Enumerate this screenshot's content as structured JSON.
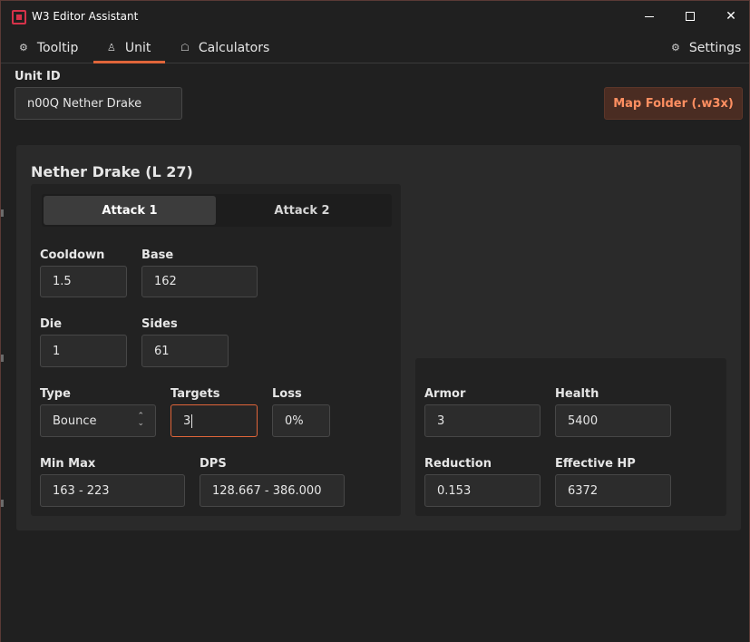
{
  "window": {
    "title": "W3 Editor Assistant"
  },
  "nav": {
    "tooltip": "Tooltip",
    "unit": "Unit",
    "calculators": "Calculators",
    "settings": "Settings"
  },
  "unit_id": {
    "label": "Unit ID",
    "value": "n00Q Nether Drake"
  },
  "map_folder_button": "Map Folder (.w3x)",
  "unit_title": "Nether Drake (L 27)",
  "tabs": [
    "Attack 1",
    "Attack 2"
  ],
  "attack": {
    "cooldown": {
      "label": "Cooldown",
      "value": "1.5"
    },
    "base": {
      "label": "Base",
      "value": "162"
    },
    "die": {
      "label": "Die",
      "value": "1"
    },
    "sides": {
      "label": "Sides",
      "value": "61"
    },
    "type": {
      "label": "Type",
      "value": "Bounce"
    },
    "targets": {
      "label": "Targets",
      "value": "3"
    },
    "loss": {
      "label": "Loss",
      "value": "0%"
    },
    "min_max": {
      "label": "Min Max",
      "value": "163 - 223"
    },
    "dps": {
      "label": "DPS",
      "value": "128.667 - 386.000"
    }
  },
  "defense": {
    "armor": {
      "label": "Armor",
      "value": "3"
    },
    "health": {
      "label": "Health",
      "value": "5400"
    },
    "reduction": {
      "label": "Reduction",
      "value": "0.153"
    },
    "effective_hp": {
      "label": "Effective HP",
      "value": "6372"
    }
  },
  "colors": {
    "accent": "#e0653a",
    "map_button_text": "#ff8f61",
    "app_icon": "#d6324a"
  },
  "icons": {
    "tooltip": "sliders-icon",
    "unit": "person-icon",
    "calculators": "calculator-icon",
    "settings": "gear-icon"
  }
}
